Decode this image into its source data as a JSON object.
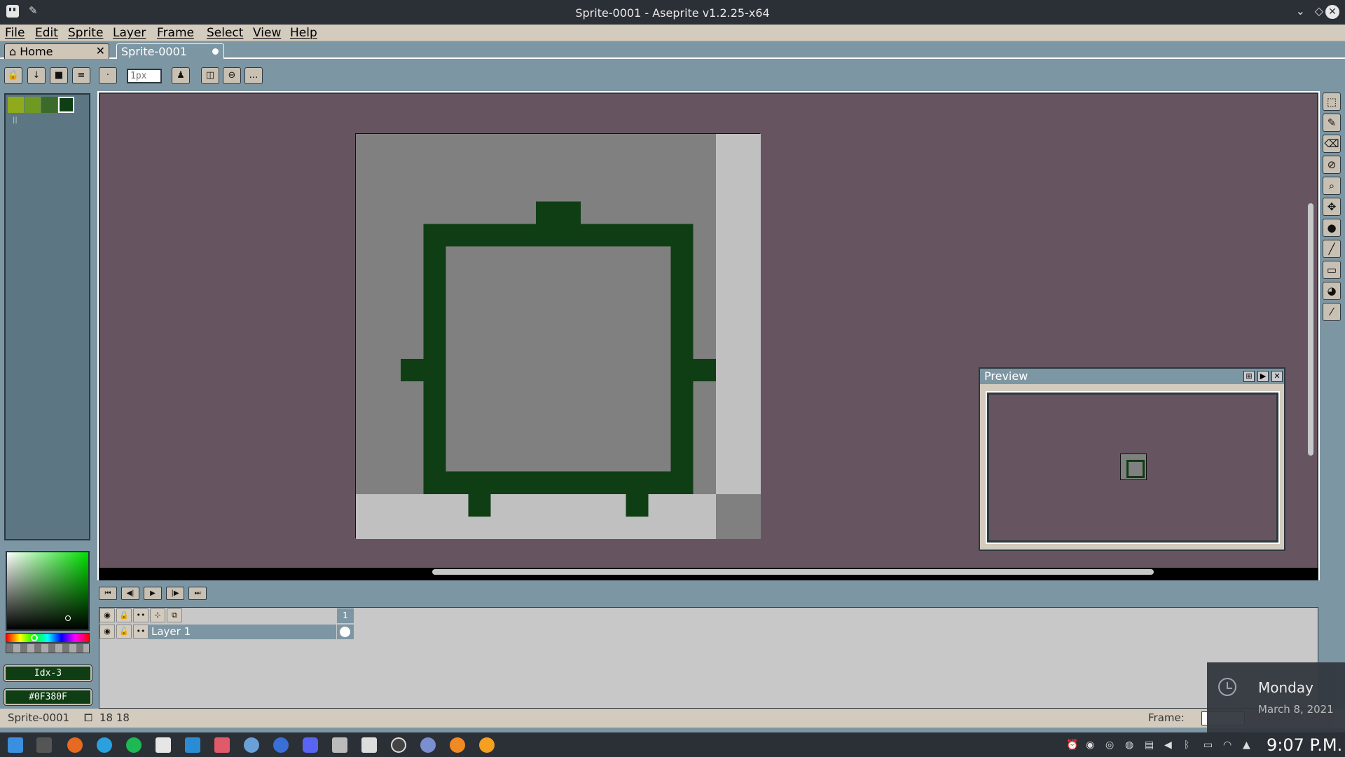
{
  "window": {
    "title": "Sprite-0001 - Aseprite v1.2.25-x64"
  },
  "menu": [
    "File",
    "Edit",
    "Sprite",
    "Layer",
    "Frame",
    "Select",
    "View",
    "Help"
  ],
  "tabs": [
    {
      "label": "Home",
      "close": "✕"
    },
    {
      "label": "Sprite-0001"
    }
  ],
  "context_bar": {
    "brush_size_placeholder": "1px"
  },
  "palette": {
    "colors": [
      "#8faa1a",
      "#6f9a22",
      "#3a6b2a",
      "#103e14"
    ],
    "selected_index_label": "Idx-3",
    "selected_hex_label": "#0F380F"
  },
  "preview": {
    "title": "Preview"
  },
  "timeline": {
    "frame_header": "1",
    "layer_name": "Layer 1"
  },
  "status": {
    "sprite_name": "Sprite-0001",
    "size": "18 18",
    "frame_label": "Frame:"
  },
  "clock_popup": {
    "day": "Monday",
    "date": "March 8, 2021"
  },
  "taskbar": {
    "time": "9:07 P.M."
  },
  "colors": {
    "canvas_bg": "#665560",
    "ui_accent": "#7d96a3",
    "sprite_outline": "#103e14",
    "sprite_fill": "#808080"
  }
}
